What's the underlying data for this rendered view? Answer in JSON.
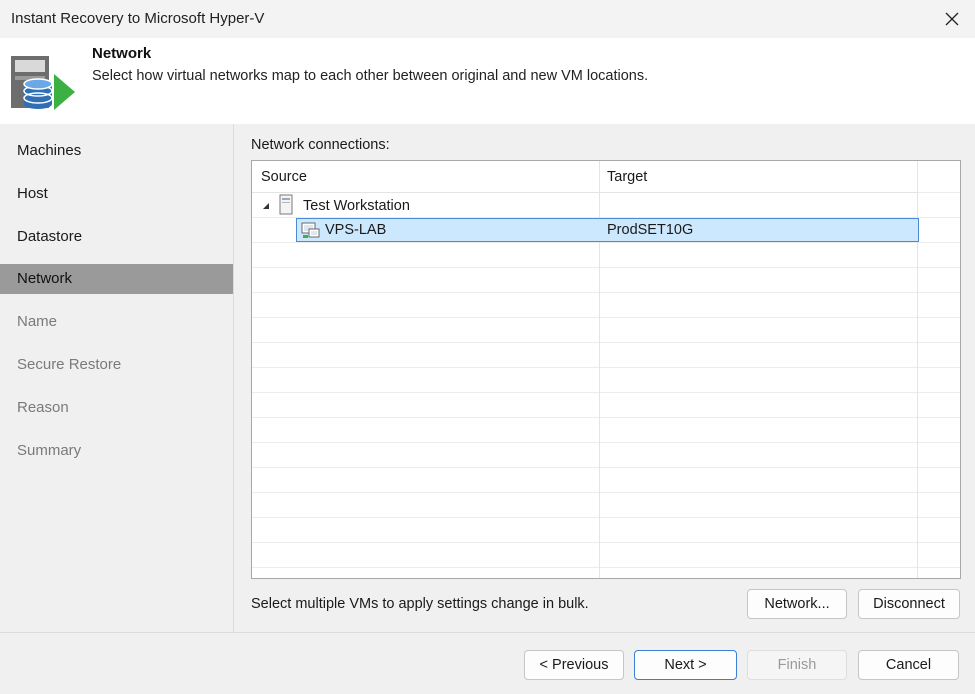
{
  "window": {
    "title": "Instant Recovery to Microsoft Hyper-V",
    "close_icon": "close-icon"
  },
  "header": {
    "step_title": "Network",
    "step_description": "Select how virtual networks map to each other between original and new VM locations.",
    "icon": "wizard-network-icon"
  },
  "sidebar": {
    "items": [
      {
        "label": "Machines",
        "state": "enabled"
      },
      {
        "label": "Host",
        "state": "enabled"
      },
      {
        "label": "Datastore",
        "state": "enabled"
      },
      {
        "label": "Network",
        "state": "active"
      },
      {
        "label": "Name",
        "state": "disabled"
      },
      {
        "label": "Secure Restore",
        "state": "disabled"
      },
      {
        "label": "Reason",
        "state": "disabled"
      },
      {
        "label": "Summary",
        "state": "disabled"
      }
    ]
  },
  "main": {
    "connections_label": "Network connections:",
    "columns": [
      "Source",
      "Target"
    ],
    "tree": {
      "parent": {
        "label": "Test Workstation",
        "expanded": true,
        "icon": "workstation-icon"
      },
      "children": [
        {
          "source": "VPS-LAB",
          "target": "ProdSET10G",
          "selected": true,
          "icon": "network-adapter-icon"
        }
      ]
    },
    "hint": "Select multiple VMs to apply settings change in bulk.",
    "network_button": "Network...",
    "disconnect_button": "Disconnect"
  },
  "footer": {
    "previous": "< Previous",
    "next": "Next >",
    "finish": "Finish",
    "cancel": "Cancel"
  },
  "colors": {
    "active_nav": "#9a9a9a",
    "selection_fill": "#cce8ff",
    "selection_border": "#4a8bd6",
    "primary_button_border": "#3b7fd4",
    "icon_green": "#3cb043",
    "icon_blue": "#2f6fb5"
  }
}
